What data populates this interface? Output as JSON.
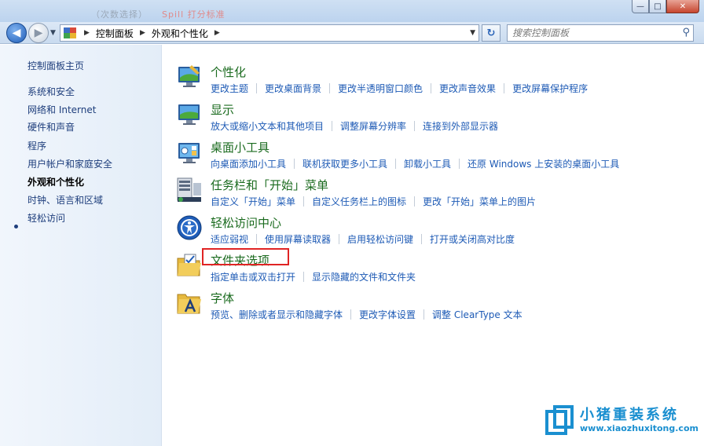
{
  "window": {
    "title_faded": "（次数选择）",
    "title_faded_red": "Spill 打分标准",
    "controls": {
      "minimize": "—",
      "maximize": "□",
      "close": "✕"
    }
  },
  "navbar": {
    "breadcrumb": [
      "控制面板",
      "外观和个性化"
    ],
    "search_placeholder": "搜索控制面板"
  },
  "sidebar": {
    "items": [
      {
        "label": "控制面板主页",
        "active": false
      },
      {
        "label": "系统和安全",
        "active": false
      },
      {
        "label": "网络和 Internet",
        "active": false
      },
      {
        "label": "硬件和声音",
        "active": false
      },
      {
        "label": "程序",
        "active": false
      },
      {
        "label": "用户帐户和家庭安全",
        "active": false
      },
      {
        "label": "外观和个性化",
        "active": true
      },
      {
        "label": "时钟、语言和区域",
        "active": false
      },
      {
        "label": "轻松访问",
        "active": false
      }
    ]
  },
  "categories": [
    {
      "title": "个性化",
      "icon": "personalization-icon",
      "links": [
        "更改主题",
        "更改桌面背景",
        "更改半透明窗口颜色",
        "更改声音效果",
        "更改屏幕保护程序"
      ]
    },
    {
      "title": "显示",
      "icon": "display-icon",
      "links": [
        "放大或缩小文本和其他项目",
        "调整屏幕分辨率",
        "连接到外部显示器"
      ]
    },
    {
      "title": "桌面小工具",
      "icon": "gadgets-icon",
      "links": [
        "向桌面添加小工具",
        "联机获取更多小工具",
        "卸载小工具",
        "还原 Windows 上安装的桌面小工具"
      ]
    },
    {
      "title": "任务栏和「开始」菜单",
      "icon": "taskbar-icon",
      "links": [
        "自定义「开始」菜单",
        "自定义任务栏上的图标",
        "更改「开始」菜单上的图片"
      ]
    },
    {
      "title": "轻松访问中心",
      "icon": "ease-of-access-icon",
      "links": [
        "适应弱视",
        "使用屏幕读取器",
        "启用轻松访问键",
        "打开或关闭高对比度"
      ]
    },
    {
      "title": "文件夹选项",
      "icon": "folder-options-icon",
      "links": [
        "指定单击或双击打开",
        "显示隐藏的文件和文件夹"
      ]
    },
    {
      "title": "字体",
      "icon": "fonts-icon",
      "links": [
        "预览、删除或者显示和隐藏字体",
        "更改字体设置",
        "调整 ClearType 文本"
      ]
    }
  ],
  "watermark": {
    "name": "小猪重装系统",
    "url": "www.xiaozhuxitong.com"
  },
  "colors": {
    "title_green": "#1b6b1f",
    "link_blue": "#1d5ab5",
    "highlight_red": "#e02424",
    "watermark_blue": "#1a8fd0"
  }
}
